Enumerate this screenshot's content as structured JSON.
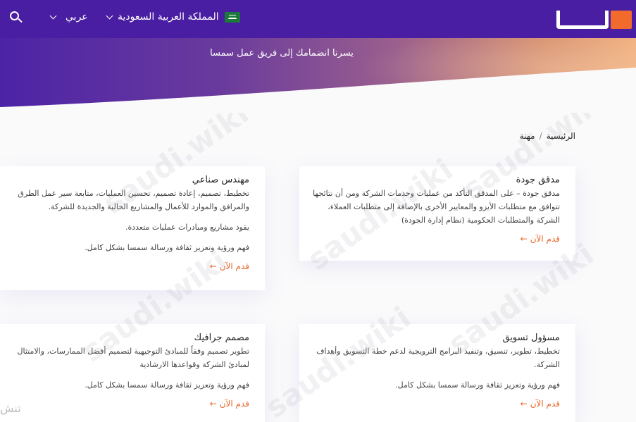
{
  "header": {
    "country": "المملكة العربية السعودية",
    "language": "عربي"
  },
  "hero": {
    "title": "يسرنا انضمامك إلى فريق عمل سمسا"
  },
  "breadcrumb": {
    "home": "الرئيسية",
    "separator": "/",
    "current": "مهنة"
  },
  "jobs": [
    {
      "title": "مدقق جودة",
      "paragraphs": [
        "مدقق جودة – على المدقق التأكد من عمليات وخدمات الشركة ومن أن نتائجها تتوافق مع متطلبات الأيزو والمعايير الأخرى بالإضافة إلى متطلبات العملاء، الشركة والمتطلبات الحكومية (نظام إدارة الجودة)"
      ],
      "apply": "قدم الآن"
    },
    {
      "title": "مهندس صناعي",
      "paragraphs": [
        "تخطيط، تصميم، إعادة تصميم، تحسين العمليات، متابعة سير عمل الطرق والمرافق والموارد للأعمال والمشاريع الحالية والجديدة للشركة.",
        "يقود مشاريع ومبادرات عمليات متعددة.",
        "فهم ورؤية وتعزيز ثقافة ورسالة سمسا بشكل كامل."
      ],
      "apply": "قدم الآن"
    },
    {
      "title": "مسؤول تسويق",
      "paragraphs": [
        "تخطيط، تطوير، تنسيق، وتنفيذ البرامج الترويجية لدعم خطة التسويق وأهداف الشركة.",
        "فهم ورؤية وتعزيز ثقافة ورسالة سمسا بشكل كامل."
      ],
      "apply": "قدم الآن"
    },
    {
      "title": "مصمم جرافيك",
      "paragraphs": [
        "تطوير تصميم وفقاً للمبادئ التوجيهية لتصميم أفضل الممارسات، والامتثال لمبادئ الشركة وقواعدها الارشادية",
        "فهم ورؤية وتعزيز ثقافة ورسالة سمسا بشكل كامل."
      ],
      "apply": "قدم الآن"
    }
  ],
  "watermark": "saudi.wiki",
  "edge_text": "تنش",
  "colors": {
    "nav": "#4a1ea3",
    "accent": "#e8692e",
    "logo_orange": "#f26a2c"
  },
  "icons": {
    "search": "search-icon",
    "flag": "saudi-flag-icon",
    "chevron": "chevron-down-icon",
    "arrow": "arrow-left-icon"
  }
}
